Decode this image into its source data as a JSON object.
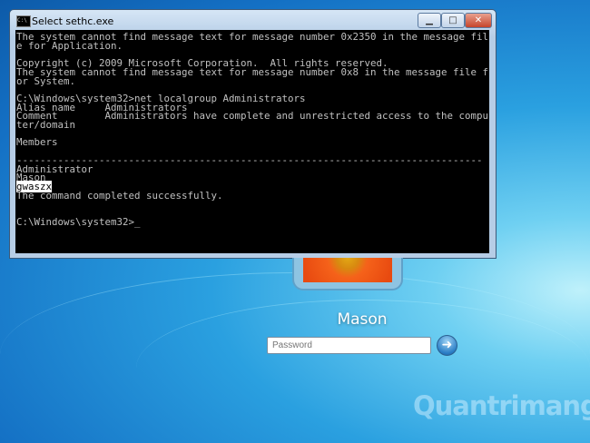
{
  "window": {
    "title": "Select sethc.exe",
    "minimize": "▁",
    "maximize": "□",
    "close": "✕"
  },
  "console_lines": [
    "The system cannot find message text for message number 0x2350 in the message fil",
    "e for Application.",
    "",
    "Copyright (c) 2009 Microsoft Corporation.  All rights reserved.",
    "The system cannot find message text for message number 0x8 in the message file f",
    "or System.",
    "",
    "C:\\Windows\\system32>net localgroup Administrators",
    "Alias name     Administrators",
    "Comment        Administrators have complete and unrestricted access to the compu",
    "ter/domain",
    "",
    "Members",
    "",
    "-------------------------------------------------------------------------------",
    "Administrator",
    "Mason"
  ],
  "selected_line": "gwaszx",
  "console_after": [
    "The command completed successfully.",
    "",
    "",
    "C:\\Windows\\system32>_"
  ],
  "login": {
    "username": "Mason",
    "password_placeholder": "Password",
    "submit": "➜"
  },
  "watermark": "Quantrimang"
}
